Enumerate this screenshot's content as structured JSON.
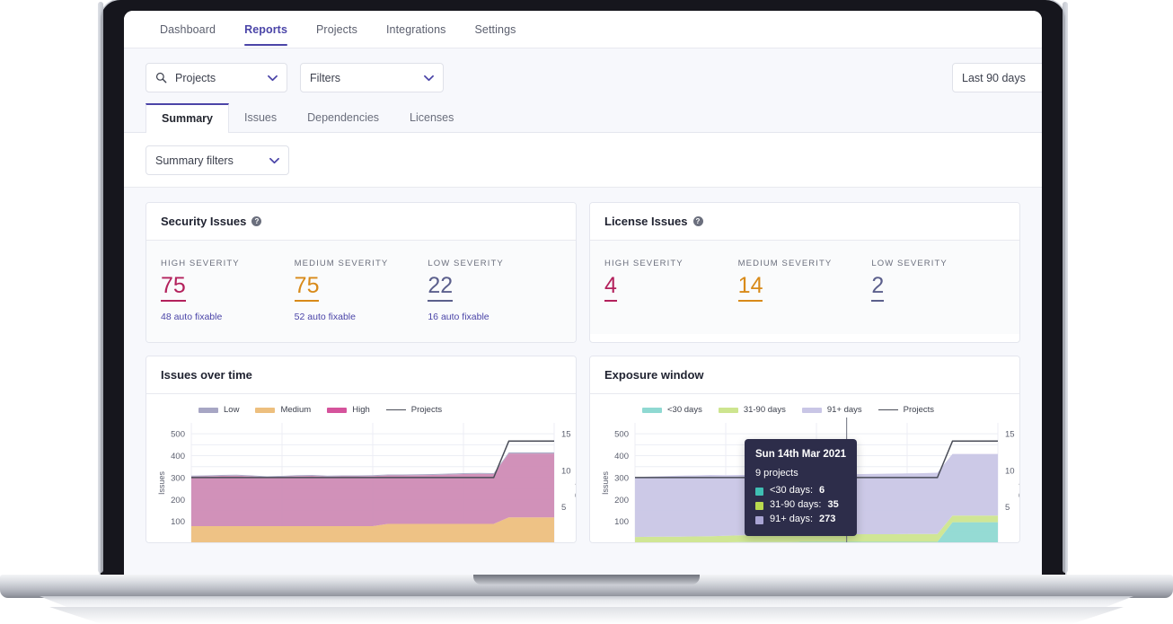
{
  "nav": {
    "items": [
      {
        "label": "Dashboard",
        "active": false
      },
      {
        "label": "Reports",
        "active": true
      },
      {
        "label": "Projects",
        "active": false
      },
      {
        "label": "Integrations",
        "active": false
      },
      {
        "label": "Settings",
        "active": false
      }
    ]
  },
  "filters": {
    "project_select": "Projects",
    "filters_select": "Filters",
    "date_range": "Last 90 days",
    "summary_filters": "Summary filters"
  },
  "tabs": [
    {
      "label": "Summary",
      "active": true
    },
    {
      "label": "Issues",
      "active": false
    },
    {
      "label": "Dependencies",
      "active": false
    },
    {
      "label": "Licenses",
      "active": false
    }
  ],
  "security_card": {
    "title": "Security Issues",
    "metrics": [
      {
        "label": "HIGH SEVERITY",
        "value": "75",
        "sub": "48 auto fixable",
        "color": "#b3215c"
      },
      {
        "label": "MEDIUM SEVERITY",
        "value": "75",
        "sub": "52 auto fixable",
        "color": "#d88a19"
      },
      {
        "label": "LOW SEVERITY",
        "value": "22",
        "sub": "16 auto fixable",
        "color": "#5b5f8c"
      }
    ]
  },
  "license_card": {
    "title": "License Issues",
    "metrics": [
      {
        "label": "HIGH SEVERITY",
        "value": "4",
        "sub": "",
        "color": "#b3215c"
      },
      {
        "label": "MEDIUM SEVERITY",
        "value": "14",
        "sub": "",
        "color": "#d88a19"
      },
      {
        "label": "LOW SEVERITY",
        "value": "2",
        "sub": "",
        "color": "#5b5f8c"
      }
    ]
  },
  "issues_chart": {
    "title": "Issues over time"
  },
  "exposure_chart": {
    "title": "Exposure window"
  },
  "tooltip": {
    "title": "Sun 14th Mar 2021",
    "projects": "9 projects",
    "rows": [
      {
        "label": "<30 days:",
        "value": "6",
        "color": "#3fbfb3"
      },
      {
        "label": "31-90 days:",
        "value": "35",
        "color": "#b9d94f"
      },
      {
        "label": "91+ days:",
        "value": "273",
        "color": "#a9a4d4"
      }
    ]
  },
  "chart_data": [
    {
      "type": "area",
      "title": "Issues over time",
      "xlabel": "",
      "ylabel": "Issues",
      "y2label": "Projects",
      "ylim": [
        0,
        550
      ],
      "y2lim": [
        0,
        16.5
      ],
      "yticks": [
        100,
        200,
        300,
        400,
        500
      ],
      "y2ticks": [
        5,
        10,
        15
      ],
      "grid": true,
      "legend_position": "top-left",
      "stacked": true,
      "x": [
        0,
        1,
        2,
        3,
        4,
        5,
        6,
        7,
        8,
        9,
        10,
        11,
        12,
        13,
        14,
        15,
        16,
        17,
        18,
        19,
        20,
        21,
        22,
        23,
        24
      ],
      "series": [
        {
          "name": "Medium",
          "color": "#edbf7e",
          "values": [
            78,
            78,
            78,
            78,
            78,
            78,
            78,
            78,
            78,
            78,
            78,
            78,
            78,
            88,
            88,
            88,
            88,
            88,
            88,
            88,
            88,
            118,
            118,
            118,
            118
          ]
        },
        {
          "name": "High",
          "color": "#cf8bb5",
          "values": [
            227,
            228,
            230,
            231,
            228,
            224,
            226,
            229,
            230,
            227,
            228,
            228,
            229,
            222,
            222,
            223,
            224,
            226,
            228,
            229,
            228,
            292,
            292,
            292,
            292
          ]
        },
        {
          "name": "Low",
          "color": "#a7a6c4",
          "values": [
            4,
            4,
            4,
            4,
            4,
            4,
            4,
            4,
            4,
            4,
            4,
            4,
            4,
            4,
            4,
            4,
            4,
            4,
            4,
            4,
            4,
            5,
            5,
            5,
            5
          ]
        }
      ],
      "line_series": {
        "name": "Projects",
        "color": "#4a4d58",
        "values": [
          9,
          9,
          9,
          9,
          9,
          9,
          9,
          9,
          9,
          9,
          9,
          9,
          9,
          9,
          9,
          9,
          9,
          9,
          9,
          9,
          9,
          14,
          14,
          14,
          14
        ]
      }
    },
    {
      "type": "area",
      "title": "Exposure window",
      "xlabel": "",
      "ylabel": "Issues",
      "y2label": "Projects",
      "ylim": [
        0,
        550
      ],
      "y2lim": [
        0,
        16.5
      ],
      "yticks": [
        100,
        200,
        300,
        400,
        500
      ],
      "y2ticks": [
        5,
        10,
        15
      ],
      "grid": true,
      "legend_position": "top-left",
      "stacked": true,
      "highlight_x_index": 14,
      "highlight_value": 303,
      "x": [
        0,
        1,
        2,
        3,
        4,
        5,
        6,
        7,
        8,
        9,
        10,
        11,
        12,
        13,
        14,
        15,
        16,
        17,
        18,
        19,
        20,
        21,
        22,
        23,
        24
      ],
      "series": [
        {
          "name": "<30 days",
          "color": "#8fd9d2",
          "values": [
            4,
            4,
            4,
            4,
            4,
            4,
            4,
            5,
            5,
            5,
            5,
            6,
            6,
            6,
            6,
            6,
            6,
            6,
            6,
            6,
            6,
            96,
            96,
            96,
            96
          ]
        },
        {
          "name": "31-90 days",
          "color": "#cde58f",
          "values": [
            24,
            25,
            26,
            26,
            27,
            28,
            30,
            31,
            32,
            32,
            33,
            34,
            34,
            35,
            35,
            35,
            35,
            35,
            36,
            36,
            36,
            30,
            30,
            30,
            30
          ]
        },
        {
          "name": "91+ days",
          "color": "#c9c6e6",
          "values": [
            274,
            276,
            277,
            279,
            279,
            280,
            277,
            276,
            275,
            276,
            275,
            273,
            274,
            273,
            273,
            275,
            276,
            277,
            277,
            278,
            280,
            282,
            282,
            282,
            282
          ]
        }
      ],
      "line_series": {
        "name": "Projects",
        "color": "#4a4d58",
        "values": [
          9,
          9,
          9,
          9,
          9,
          9,
          9,
          9,
          9,
          9,
          9,
          9,
          9,
          9,
          9,
          9,
          9,
          9,
          9,
          9,
          9,
          14,
          14,
          14,
          14
        ]
      }
    }
  ]
}
